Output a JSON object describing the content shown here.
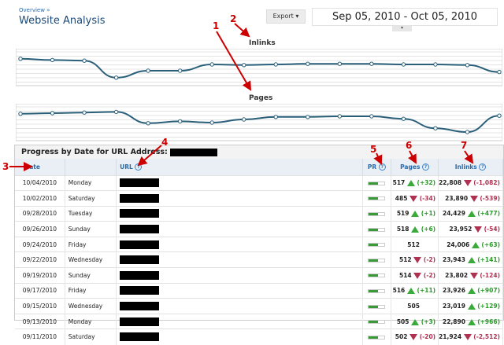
{
  "breadcrumb": "Overview »",
  "title": "Website Analysis",
  "export_label": "Export ▾",
  "date_range": "Sep 05, 2010 - Oct 05, 2010",
  "date_toggle": "▾",
  "annotations": [
    "1",
    "2",
    "3",
    "4",
    "5",
    "6",
    "7"
  ],
  "chart_data": [
    {
      "type": "line",
      "title": "Inlinks",
      "values": [
        79,
        77,
        76,
        49,
        60,
        60,
        70,
        69,
        70,
        71,
        71,
        71,
        70,
        70,
        69,
        58
      ]
    },
    {
      "type": "line",
      "title": "Pages",
      "values": [
        79,
        80,
        81,
        82,
        64,
        67,
        65,
        70,
        74,
        74,
        75,
        75,
        71,
        56,
        50,
        76
      ]
    }
  ],
  "panel_title": "Progress by Date for URL Address:",
  "columns": {
    "date": "Date",
    "url": "URL",
    "pr": "PR",
    "pages": "Pages",
    "inlinks": "Inlinks",
    "help": "?"
  },
  "colors": {
    "up": "#2a9a2a",
    "down": "#b03050",
    "accent": "#2a6aa8"
  },
  "rows": [
    {
      "date": "10/04/2010",
      "day": "Monday",
      "pr": 0.6,
      "pages": "517",
      "pd": "up",
      "pc": "(+32)",
      "inlinks": "22,808",
      "id": "dn",
      "ic": "(-1,082)"
    },
    {
      "date": "10/02/2010",
      "day": "Saturday",
      "pr": 0.6,
      "pages": "485",
      "pd": "dn",
      "pc": "(-34)",
      "inlinks": "23,890",
      "id": "dn",
      "ic": "(-539)"
    },
    {
      "date": "09/28/2010",
      "day": "Tuesday",
      "pr": 0.6,
      "pages": "519",
      "pd": "up",
      "pc": "(+1)",
      "inlinks": "24,429",
      "id": "up",
      "ic": "(+477)"
    },
    {
      "date": "09/26/2010",
      "day": "Sunday",
      "pr": 0.6,
      "pages": "518",
      "pd": "up",
      "pc": "(+6)",
      "inlinks": "23,952",
      "id": "dn",
      "ic": "(-54)"
    },
    {
      "date": "09/24/2010",
      "day": "Friday",
      "pr": 0.6,
      "pages": "512",
      "pd": "",
      "pc": "",
      "inlinks": "24,006",
      "id": "up",
      "ic": "(+63)"
    },
    {
      "date": "09/22/2010",
      "day": "Wednesday",
      "pr": 0.6,
      "pages": "512",
      "pd": "dn",
      "pc": "(-2)",
      "inlinks": "23,943",
      "id": "up",
      "ic": "(+141)"
    },
    {
      "date": "09/19/2010",
      "day": "Sunday",
      "pr": 0.6,
      "pages": "514",
      "pd": "dn",
      "pc": "(-2)",
      "inlinks": "23,802",
      "id": "dn",
      "ic": "(-124)"
    },
    {
      "date": "09/17/2010",
      "day": "Friday",
      "pr": 0.6,
      "pages": "516",
      "pd": "up",
      "pc": "(+11)",
      "inlinks": "23,926",
      "id": "up",
      "ic": "(+907)"
    },
    {
      "date": "09/15/2010",
      "day": "Wednesday",
      "pr": 0.6,
      "pages": "505",
      "pd": "",
      "pc": "",
      "inlinks": "23,019",
      "id": "up",
      "ic": "(+129)"
    },
    {
      "date": "09/13/2010",
      "day": "Monday",
      "pr": 0.6,
      "pages": "505",
      "pd": "up",
      "pc": "(+3)",
      "inlinks": "22,890",
      "id": "up",
      "ic": "(+966)"
    },
    {
      "date": "09/11/2010",
      "day": "Saturday",
      "pr": 0.6,
      "pages": "502",
      "pd": "dn",
      "pc": "(-20)",
      "inlinks": "21,924",
      "id": "dn",
      "ic": "(-2,512)"
    }
  ]
}
